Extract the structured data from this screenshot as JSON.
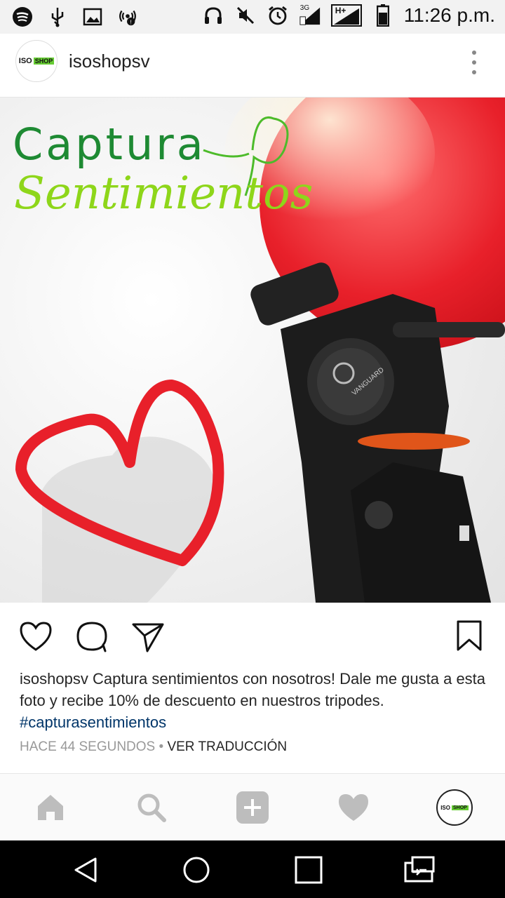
{
  "status_bar": {
    "time": "11:26 p.m.",
    "network_label_1": "3G",
    "network_label_2": "H+",
    "left_icons": [
      "spotify-icon",
      "usb-icon",
      "image-icon",
      "wifi-hotspot-icon"
    ],
    "right_icons": [
      "headphones-icon",
      "mute-icon",
      "alarm-icon",
      "signal-3g-icon",
      "signal-hplus-icon",
      "battery-icon"
    ]
  },
  "post": {
    "username": "isoshopsv",
    "avatar_logo": {
      "iso": "ISO",
      "shop": "SHOP"
    },
    "image": {
      "headline_line1": "Captura",
      "headline_line2": "Sentimientos",
      "brand": "VANGUARD"
    },
    "caption_user": "isoshopsv",
    "caption_text": " Captura sentimientos con nosotros! Dale me gusta a esta foto y recibe 10% de descuento en nuestros tripodes.",
    "hashtag": "#capturasentimientos",
    "time_ago": "HACE 44 SEGUNDOS",
    "separator": " • ",
    "translate_label": "VER TRADUCCIÓN"
  },
  "actions": [
    "like-icon",
    "comment-icon",
    "share-icon",
    "bookmark-icon"
  ],
  "bottom_nav": [
    "home-icon",
    "search-icon",
    "add-icon",
    "activity-icon",
    "profile-avatar"
  ],
  "colors": {
    "accent_link": "#003569",
    "headline_green": "#1e8a33",
    "headline_lime": "#8ed61a",
    "heart_red": "#e8202a"
  }
}
